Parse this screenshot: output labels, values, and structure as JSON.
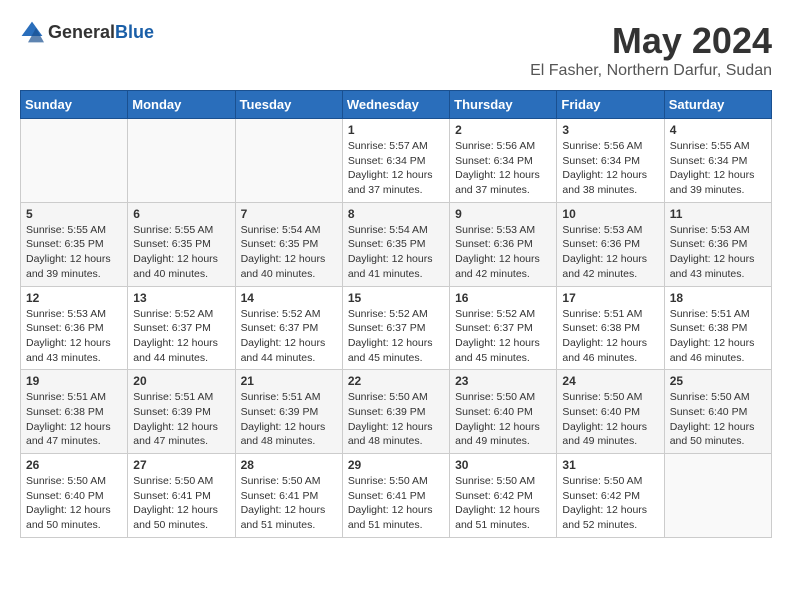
{
  "header": {
    "logo_general": "General",
    "logo_blue": "Blue",
    "month": "May 2024",
    "location": "El Fasher, Northern Darfur, Sudan"
  },
  "days_of_week": [
    "Sunday",
    "Monday",
    "Tuesday",
    "Wednesday",
    "Thursday",
    "Friday",
    "Saturday"
  ],
  "weeks": [
    [
      {
        "day": "",
        "content": ""
      },
      {
        "day": "",
        "content": ""
      },
      {
        "day": "",
        "content": ""
      },
      {
        "day": "1",
        "content": "Sunrise: 5:57 AM\nSunset: 6:34 PM\nDaylight: 12 hours and 37 minutes."
      },
      {
        "day": "2",
        "content": "Sunrise: 5:56 AM\nSunset: 6:34 PM\nDaylight: 12 hours and 37 minutes."
      },
      {
        "day": "3",
        "content": "Sunrise: 5:56 AM\nSunset: 6:34 PM\nDaylight: 12 hours and 38 minutes."
      },
      {
        "day": "4",
        "content": "Sunrise: 5:55 AM\nSunset: 6:34 PM\nDaylight: 12 hours and 39 minutes."
      }
    ],
    [
      {
        "day": "5",
        "content": "Sunrise: 5:55 AM\nSunset: 6:35 PM\nDaylight: 12 hours and 39 minutes."
      },
      {
        "day": "6",
        "content": "Sunrise: 5:55 AM\nSunset: 6:35 PM\nDaylight: 12 hours and 40 minutes."
      },
      {
        "day": "7",
        "content": "Sunrise: 5:54 AM\nSunset: 6:35 PM\nDaylight: 12 hours and 40 minutes."
      },
      {
        "day": "8",
        "content": "Sunrise: 5:54 AM\nSunset: 6:35 PM\nDaylight: 12 hours and 41 minutes."
      },
      {
        "day": "9",
        "content": "Sunrise: 5:53 AM\nSunset: 6:36 PM\nDaylight: 12 hours and 42 minutes."
      },
      {
        "day": "10",
        "content": "Sunrise: 5:53 AM\nSunset: 6:36 PM\nDaylight: 12 hours and 42 minutes."
      },
      {
        "day": "11",
        "content": "Sunrise: 5:53 AM\nSunset: 6:36 PM\nDaylight: 12 hours and 43 minutes."
      }
    ],
    [
      {
        "day": "12",
        "content": "Sunrise: 5:53 AM\nSunset: 6:36 PM\nDaylight: 12 hours and 43 minutes."
      },
      {
        "day": "13",
        "content": "Sunrise: 5:52 AM\nSunset: 6:37 PM\nDaylight: 12 hours and 44 minutes."
      },
      {
        "day": "14",
        "content": "Sunrise: 5:52 AM\nSunset: 6:37 PM\nDaylight: 12 hours and 44 minutes."
      },
      {
        "day": "15",
        "content": "Sunrise: 5:52 AM\nSunset: 6:37 PM\nDaylight: 12 hours and 45 minutes."
      },
      {
        "day": "16",
        "content": "Sunrise: 5:52 AM\nSunset: 6:37 PM\nDaylight: 12 hours and 45 minutes."
      },
      {
        "day": "17",
        "content": "Sunrise: 5:51 AM\nSunset: 6:38 PM\nDaylight: 12 hours and 46 minutes."
      },
      {
        "day": "18",
        "content": "Sunrise: 5:51 AM\nSunset: 6:38 PM\nDaylight: 12 hours and 46 minutes."
      }
    ],
    [
      {
        "day": "19",
        "content": "Sunrise: 5:51 AM\nSunset: 6:38 PM\nDaylight: 12 hours and 47 minutes."
      },
      {
        "day": "20",
        "content": "Sunrise: 5:51 AM\nSunset: 6:39 PM\nDaylight: 12 hours and 47 minutes."
      },
      {
        "day": "21",
        "content": "Sunrise: 5:51 AM\nSunset: 6:39 PM\nDaylight: 12 hours and 48 minutes."
      },
      {
        "day": "22",
        "content": "Sunrise: 5:50 AM\nSunset: 6:39 PM\nDaylight: 12 hours and 48 minutes."
      },
      {
        "day": "23",
        "content": "Sunrise: 5:50 AM\nSunset: 6:40 PM\nDaylight: 12 hours and 49 minutes."
      },
      {
        "day": "24",
        "content": "Sunrise: 5:50 AM\nSunset: 6:40 PM\nDaylight: 12 hours and 49 minutes."
      },
      {
        "day": "25",
        "content": "Sunrise: 5:50 AM\nSunset: 6:40 PM\nDaylight: 12 hours and 50 minutes."
      }
    ],
    [
      {
        "day": "26",
        "content": "Sunrise: 5:50 AM\nSunset: 6:40 PM\nDaylight: 12 hours and 50 minutes."
      },
      {
        "day": "27",
        "content": "Sunrise: 5:50 AM\nSunset: 6:41 PM\nDaylight: 12 hours and 50 minutes."
      },
      {
        "day": "28",
        "content": "Sunrise: 5:50 AM\nSunset: 6:41 PM\nDaylight: 12 hours and 51 minutes."
      },
      {
        "day": "29",
        "content": "Sunrise: 5:50 AM\nSunset: 6:41 PM\nDaylight: 12 hours and 51 minutes."
      },
      {
        "day": "30",
        "content": "Sunrise: 5:50 AM\nSunset: 6:42 PM\nDaylight: 12 hours and 51 minutes."
      },
      {
        "day": "31",
        "content": "Sunrise: 5:50 AM\nSunset: 6:42 PM\nDaylight: 12 hours and 52 minutes."
      },
      {
        "day": "",
        "content": ""
      }
    ]
  ]
}
